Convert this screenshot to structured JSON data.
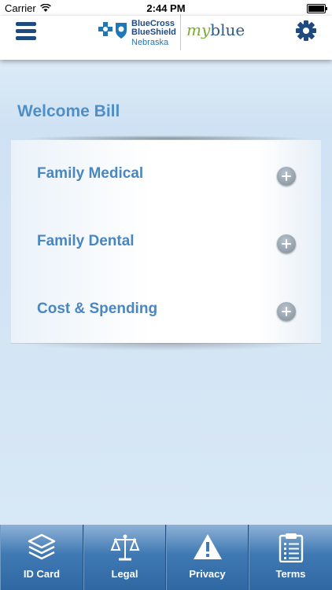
{
  "status_bar": {
    "carrier": "Carrier",
    "time": "2:44 PM"
  },
  "header": {
    "logo_line1": "BlueCross",
    "logo_line2": "BlueShield",
    "logo_line3": "Nebraska",
    "brand_my": "my",
    "brand_blue": "blue",
    "menu_icon": "hamburger-icon",
    "settings_icon": "gear-icon"
  },
  "welcome": "Welcome Bill",
  "sections": [
    {
      "label": "Family Medical",
      "icon": "plus-circle-icon"
    },
    {
      "label": "Family Dental",
      "icon": "plus-circle-icon"
    },
    {
      "label": "Cost & Spending",
      "icon": "plus-circle-icon"
    }
  ],
  "tabs": [
    {
      "label": "ID Card",
      "icon": "layers-icon"
    },
    {
      "label": "Legal",
      "icon": "scales-icon"
    },
    {
      "label": "Privacy",
      "icon": "warning-icon"
    },
    {
      "label": "Terms",
      "icon": "clipboard-icon"
    }
  ],
  "colors": {
    "accent": "#4a86bf",
    "nav_dark": "#1f4a80",
    "tabbar": "#3f79b3",
    "brand_green": "#7aab2f"
  }
}
